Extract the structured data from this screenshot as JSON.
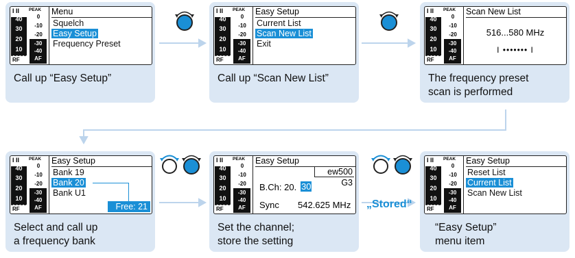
{
  "meter": {
    "rf_header": "I II",
    "rf_db": "40",
    "rf_values": [
      "30",
      "20",
      "10"
    ],
    "rf_label": "RF",
    "af_peak": "PEAK",
    "af_values": [
      "0",
      "-10",
      "-20"
    ],
    "af_bar_values": [
      "-30",
      "-40"
    ],
    "af_label": "AF"
  },
  "step1": {
    "title": "Menu",
    "items": [
      "Squelch",
      "Easy Setup",
      "Frequency Preset"
    ],
    "selected_index": 1,
    "caption": "Call up “Easy Setup”"
  },
  "step2": {
    "title": "Easy Setup",
    "items": [
      "Current List",
      "Scan New List",
      "Exit"
    ],
    "selected_index": 1,
    "caption": "Call up “Scan New List”"
  },
  "step3": {
    "title": "Scan New List",
    "range": "516...580 MHz",
    "progress": "I ••••••• I",
    "caption_lines": [
      "The frequency preset",
      "scan is performed"
    ]
  },
  "step4": {
    "title": "Easy Setup",
    "items": [
      "Bank 19",
      "Bank 20",
      "Bank U1"
    ],
    "selected_index": 1,
    "free": "Free: 21",
    "caption_lines": [
      "Select and call up",
      "a frequency bank"
    ]
  },
  "step5": {
    "title": "Easy Setup",
    "device": "ew500 G3",
    "channel_label": "B.Ch: 20.",
    "channel_value": "30",
    "sync_label": "Sync",
    "sync_freq": "542.625 MHz",
    "caption_lines": [
      "Set the channel;",
      "store the setting"
    ]
  },
  "stored_label": "„Stored“",
  "step6": {
    "title": "Easy Setup",
    "items": [
      "Reset List",
      "Current List",
      "Scan New List"
    ],
    "selected_index": 1,
    "caption_lines": [
      "“Easy Setup”",
      "menu item"
    ]
  },
  "colors": {
    "accent": "#1a8fd6",
    "card": "#dbe7f4",
    "arrow": "#bcd4ec"
  },
  "icons": [
    "jog-dial-press-icon",
    "jog-dial-turn-icon",
    "flow-arrow-icon"
  ]
}
